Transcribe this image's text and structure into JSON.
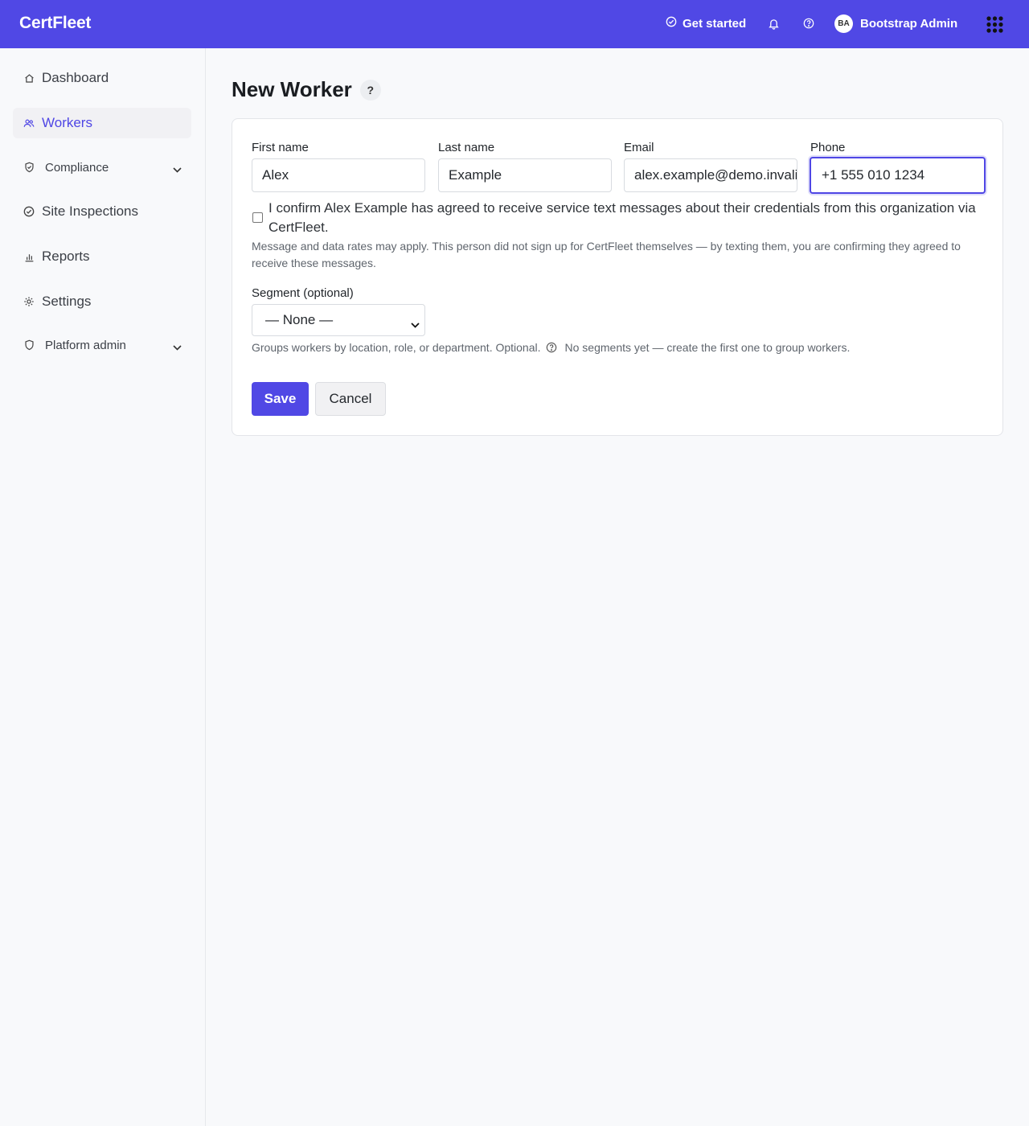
{
  "app": {
    "brand": "CertFleet",
    "accent_color": "#5048e5"
  },
  "topbar": {
    "get_started": "Get started",
    "get_started_icon": "check-circle-icon",
    "notifications_icon": "bell-icon",
    "help_icon": "question-circle-icon",
    "user": {
      "initials": "BA",
      "name": "Bootstrap Admin"
    },
    "apps_icon": "grid-dots-icon"
  },
  "sidebar": {
    "items": [
      {
        "label": "Dashboard",
        "icon": "home-icon",
        "active": false
      },
      {
        "label": "Workers",
        "icon": "users-icon",
        "active": true
      },
      {
        "label": "Compliance",
        "icon": "shield-check-icon",
        "expandable": true
      },
      {
        "label": "Site Inspections",
        "icon": "check-circle-icon",
        "active": false
      },
      {
        "label": "Reports",
        "icon": "bar-chart-icon",
        "active": false
      },
      {
        "label": "Settings",
        "icon": "gear-icon",
        "active": false
      },
      {
        "label": "Platform admin",
        "icon": "shield-icon",
        "expandable": true
      }
    ]
  },
  "page": {
    "title": "New Worker",
    "help_label": "?"
  },
  "form": {
    "first_name": {
      "label": "First name",
      "value": "Alex"
    },
    "last_name": {
      "label": "Last name",
      "value": "Example"
    },
    "email": {
      "label": "Email",
      "value": "alex.example@demo.invalid"
    },
    "phone": {
      "label": "Phone",
      "value": "+1 555 010 1234"
    },
    "consent": {
      "checked": false,
      "label": "I confirm Alex Example has agreed to receive service text messages about their credentials from this organization via CertFleet.",
      "hint": "Message and data rates may apply. This person did not sign up for CertFleet themselves — by texting them, you are confirming they agreed to receive these messages."
    },
    "segment": {
      "label": "Segment (optional)",
      "selected": "— None —",
      "hint": "Groups workers by location, role, or department. Optional.",
      "empty_note": "No segments yet — create the first one to group workers."
    },
    "save_label": "Save",
    "cancel_label": "Cancel"
  }
}
